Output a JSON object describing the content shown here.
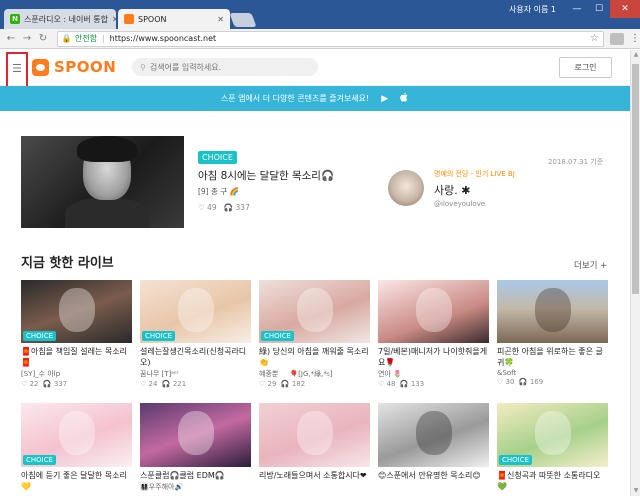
{
  "browser": {
    "tabs": [
      {
        "title": "스푼라디오 : 네이버 통합",
        "favicon_color": "#2db400",
        "favicon_glyph": "N",
        "active": false
      },
      {
        "title": "SPOON",
        "favicon_color": "#ff7b1c",
        "favicon_glyph": "",
        "active": true
      }
    ],
    "window_user": "사용자 이름 1",
    "window_buttons": {
      "minimize": "—",
      "maximize": "☐",
      "close": "✕"
    },
    "nav": {
      "back": "←",
      "forward": "→",
      "reload": "↻"
    },
    "secure_label": "안전함",
    "url": "https://www.spooncast.net"
  },
  "header": {
    "logo_text": "SPOON",
    "search_placeholder": "검색어를 입력하세요.",
    "login_label": "로그인",
    "menu_icon": "☰"
  },
  "banner": {
    "text": "스푼 앱에서 더 다양한 콘텐츠를 즐겨보세요!",
    "playstore_icon": "▶",
    "appstore_icon": ""
  },
  "featured": {
    "badge": "CHOICE",
    "title": "아침 8시에는 달달한 목소리🎧",
    "author": "[9] 종 구 🌈",
    "likes": "♡ 49",
    "listeners": "🎧 337"
  },
  "hall_of_fame": {
    "date": "2018.07.31 기준",
    "label": "명예의 전당 - 인기 LIVE BJ",
    "name": "사랑. ✱",
    "handle": "@iloveyoulove"
  },
  "live_section": {
    "title": "지금 핫한 라이브",
    "more_label": "더보기 +",
    "row1": [
      {
        "badge": "CHOICE",
        "title": "🧧아침을 책임질 설레는 목소리🧧",
        "author": "[SY]_수 아lp",
        "likes": "♡ 22",
        "listeners": "🎧 337",
        "thumb": "t-dark"
      },
      {
        "badge": "CHOICE",
        "title": "설레는잘생긴목소리(신청곡라디오)",
        "author": "꿈나무 [T]ᵃᵉᶦ",
        "likes": "♡ 24",
        "listeners": "🎧 221",
        "thumb": "t-illust"
      },
      {
        "badge": "CHOICE",
        "title": "綠) 당신의 아침을 깨워줄 목소리👏",
        "author": "혜중뿐",
        "likes": "♡ 29",
        "listeners": "🎧 182",
        "thumb": "t-girl",
        "extra_author": "🎈[JG,*綠,*₅]"
      },
      {
        "badge": "",
        "title": "7일/베본)매니저가 나이핫줘을게요🌹",
        "author": "연아 🌷",
        "likes": "♡ 48",
        "listeners": "🎧 133",
        "thumb": "t-girl2"
      },
      {
        "badge": "",
        "title": "피곤한 아침을 위로하는 좋은 글귀🍀",
        "author": "&Soft",
        "likes": "♡ 30",
        "listeners": "🎧 169",
        "thumb": "t-canyon"
      }
    ],
    "row2": [
      {
        "badge": "CHOICE",
        "title": "아침에 듣기 좋은 달달한 목소리💛",
        "thumb": "t-pink"
      },
      {
        "badge": "",
        "title": "스푼클럽🎧클럽 EDM🎧",
        "extra_author": "👩‍👩‍👧‍👦우주해아🔊",
        "thumb": "t-club"
      },
      {
        "badge": "",
        "title": "리방/노래들으며서 소통합시다❤",
        "thumb": "t-blossom"
      },
      {
        "badge": "",
        "title": "😊스푼에서 안유명한 목소리😊",
        "thumb": "t-boy"
      },
      {
        "badge": "CHOICE",
        "title": "🧧신청곡과 따뜻한 소통라디오💚",
        "thumb": "t-cartoon"
      }
    ]
  },
  "scrollbar": {
    "up": "▲",
    "down": "▼"
  }
}
